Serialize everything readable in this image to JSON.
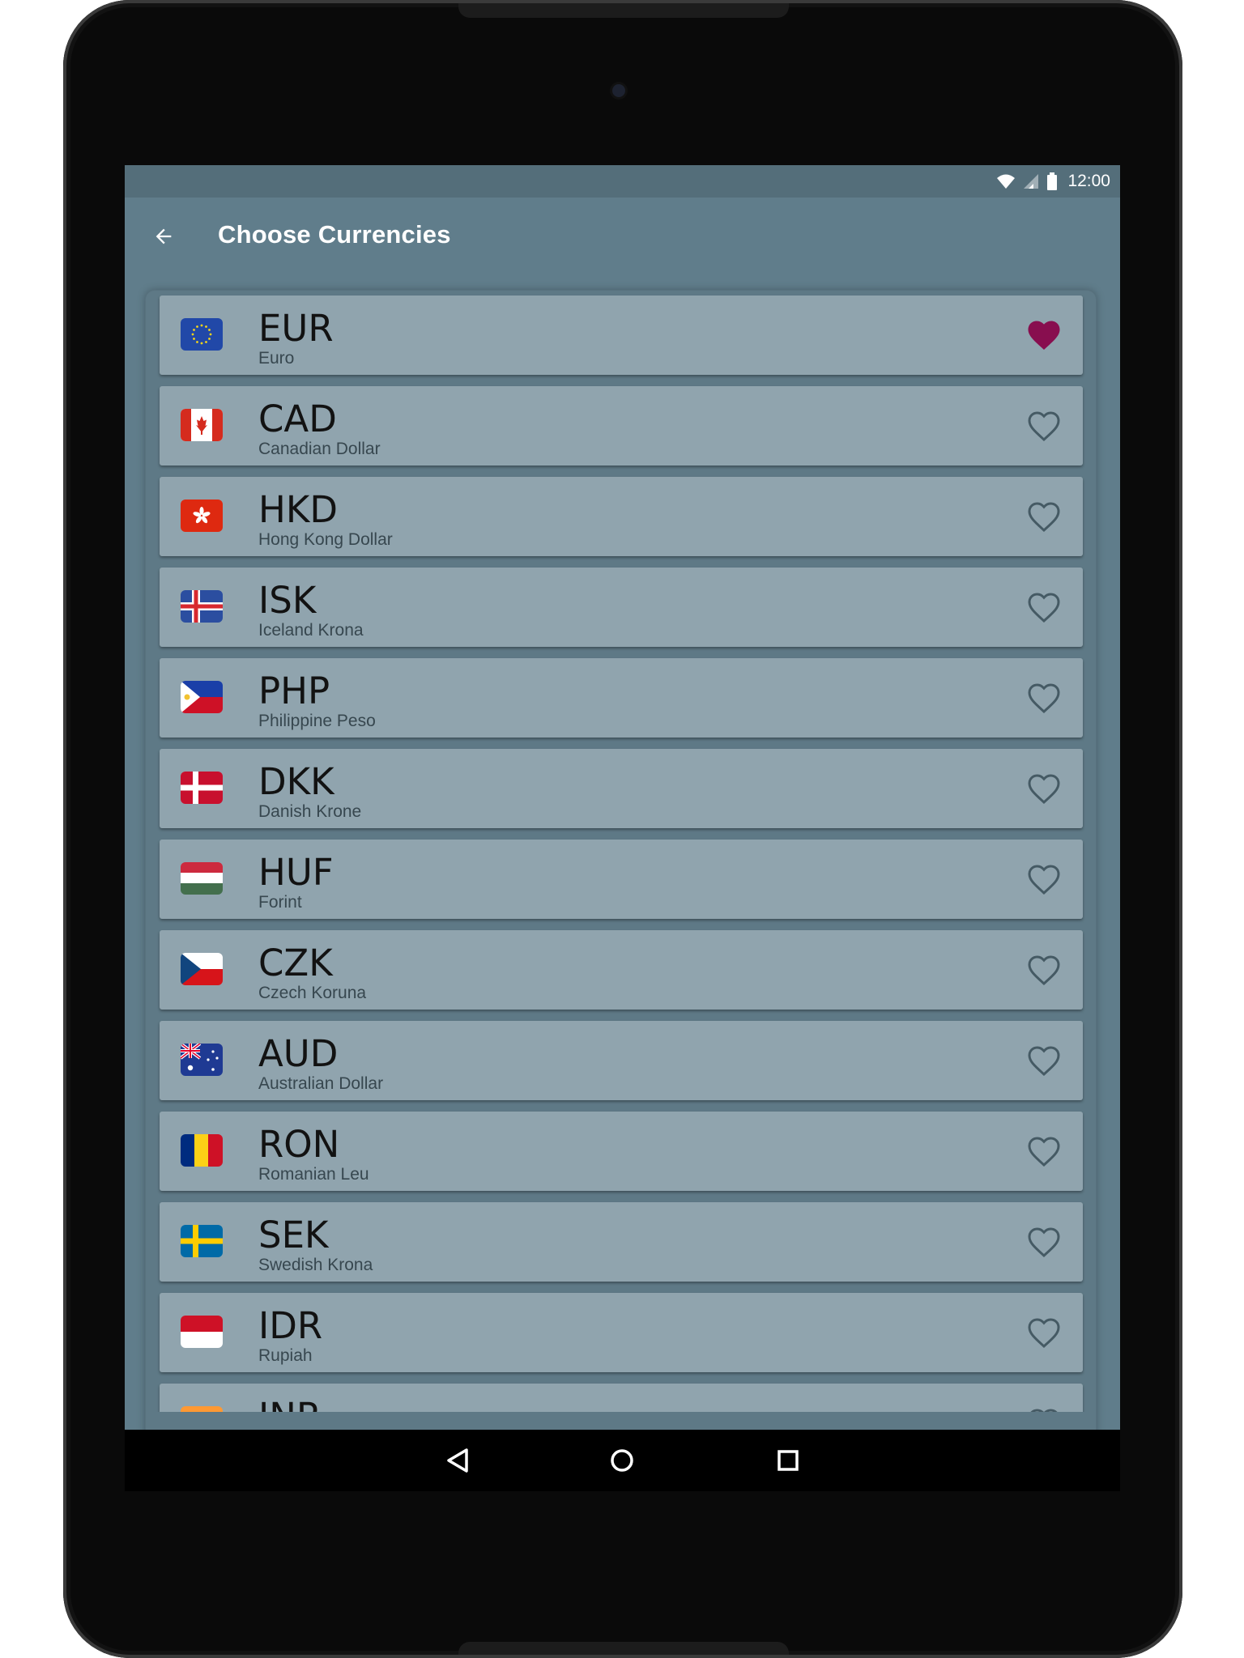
{
  "status_bar": {
    "time": "12:00"
  },
  "app_bar": {
    "title": "Choose Currencies"
  },
  "colors": {
    "app_bar": "#607d8b",
    "status_bar": "#546e7a",
    "row_background": "#90a4ae",
    "favorite_active": "#880e4f",
    "favorite_inactive": "#455a64"
  },
  "currencies": [
    {
      "code": "EUR",
      "name": "Euro",
      "flag_icon": "eu-flag-icon",
      "favorite": true
    },
    {
      "code": "CAD",
      "name": "Canadian Dollar",
      "flag_icon": "canada-flag-icon",
      "favorite": false
    },
    {
      "code": "HKD",
      "name": "Hong Kong Dollar",
      "flag_icon": "hong-kong-flag-icon",
      "favorite": false
    },
    {
      "code": "ISK",
      "name": "Iceland Krona",
      "flag_icon": "iceland-flag-icon",
      "favorite": false
    },
    {
      "code": "PHP",
      "name": "Philippine Peso",
      "flag_icon": "philippines-flag-icon",
      "favorite": false
    },
    {
      "code": "DKK",
      "name": "Danish Krone",
      "flag_icon": "denmark-flag-icon",
      "favorite": false
    },
    {
      "code": "HUF",
      "name": "Forint",
      "flag_icon": "hungary-flag-icon",
      "favorite": false
    },
    {
      "code": "CZK",
      "name": "Czech Koruna",
      "flag_icon": "czech-flag-icon",
      "favorite": false
    },
    {
      "code": "AUD",
      "name": "Australian Dollar",
      "flag_icon": "australia-flag-icon",
      "favorite": false
    },
    {
      "code": "RON",
      "name": "Romanian Leu",
      "flag_icon": "romania-flag-icon",
      "favorite": false
    },
    {
      "code": "SEK",
      "name": "Swedish Krona",
      "flag_icon": "sweden-flag-icon",
      "favorite": false
    },
    {
      "code": "IDR",
      "name": "Rupiah",
      "flag_icon": "indonesia-flag-icon",
      "favorite": false
    },
    {
      "code": "INR",
      "name": "",
      "flag_icon": "india-flag-icon",
      "favorite": false
    }
  ]
}
